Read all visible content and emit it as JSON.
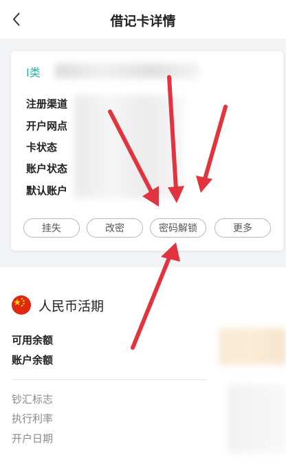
{
  "header": {
    "title": "借记卡详情",
    "back_icon": "chevron-left-icon"
  },
  "card": {
    "type_label": "I类",
    "rows": [
      "注册渠道",
      "开户网点",
      "卡状态",
      "账户状态",
      "默认账户"
    ],
    "buttons": [
      "挂失",
      "改密",
      "密码解锁",
      "更多"
    ]
  },
  "account": {
    "currency_title": "人民币活期",
    "flag_icon": "china-flag-icon",
    "balance_labels": [
      "可用余额",
      "账户余额"
    ],
    "info_labels": [
      "钞汇标志",
      "执行利率",
      "开户日期"
    ]
  },
  "colors": {
    "accent": "#2ab3a7",
    "arrow": "#e2343f",
    "flag_red": "#de2910",
    "flag_yellow": "#ffde00"
  }
}
